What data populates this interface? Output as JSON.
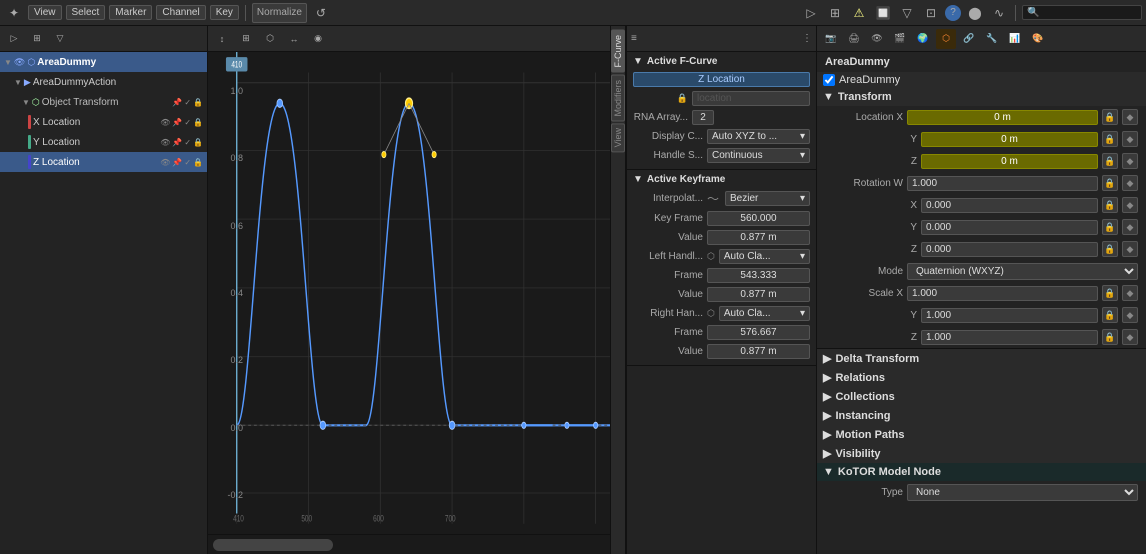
{
  "top_toolbar": {
    "menu_items": [
      "View",
      "Select",
      "Marker",
      "Channel",
      "Key"
    ],
    "normalize_label": "Normalize",
    "search_placeholder": ""
  },
  "left_panel": {
    "title": "AreaDummy",
    "action_name": "AreaDummyAction",
    "transform_label": "Object Transform",
    "channels": [
      {
        "id": "x-location",
        "label": "X Location",
        "color": "red"
      },
      {
        "id": "y-location",
        "label": "Y Location",
        "color": "green"
      },
      {
        "id": "z-location",
        "label": "Z Location",
        "color": "blue"
      }
    ]
  },
  "graph_editor": {
    "y_labels": [
      "1.0",
      "0.8",
      "0.6",
      "0.4",
      "0.2",
      "0.0",
      "-0.2"
    ],
    "x_labels": [
      "410",
      "500",
      "600",
      "700"
    ],
    "frame_current": "410"
  },
  "fcurve_tabs": [
    {
      "id": "fcurve",
      "label": "F-Curve",
      "active": true
    },
    {
      "id": "modifiers",
      "label": "Modifiers",
      "active": false
    },
    {
      "id": "view",
      "label": "View",
      "active": false
    }
  ],
  "active_fcurve": {
    "section_title": "Active F-Curve",
    "curve_label": "Z Location",
    "rna_label": "location",
    "rna_array_label": "RNA Array...",
    "rna_array_value": "2",
    "display_label": "Display C...",
    "display_value": "Auto XYZ to ...",
    "handle_label": "Handle S...",
    "handle_value": "Continuous",
    "active_keyframe_title": "Active Keyframe",
    "interpolation_label": "Interpolat...",
    "interpolation_value": "Bezier",
    "keyframe_label": "Key Frame",
    "keyframe_value": "560.000",
    "value_label": "Value",
    "value_value": "0.877 m",
    "left_handle_label": "Left Handl...",
    "left_handle_value": "Auto Cla...",
    "left_frame_label": "Frame",
    "left_frame_value": "543.333",
    "left_value_label": "Value",
    "left_value_value": "0.877 m",
    "right_handle_label": "Right Han...",
    "right_handle_value": "Auto Cla...",
    "right_frame_label": "Frame",
    "right_frame_value": "576.667",
    "right_value_label": "Value",
    "right_value_value": "0.877 m"
  },
  "properties_panel": {
    "object_name": "AreaDummy",
    "transform_label": "Transform",
    "location_x_label": "Location X",
    "location_x_value": "0 m",
    "location_y_label": "Y",
    "location_y_value": "0 m",
    "location_z_label": "Z",
    "location_z_value": "0 m",
    "rotation_w_label": "Rotation W",
    "rotation_w_value": "1.000",
    "rotation_x_label": "X",
    "rotation_x_value": "0.000",
    "rotation_y_label": "Y",
    "rotation_y_value": "0.000",
    "rotation_z_label": "Z",
    "rotation_z_value": "0.000",
    "mode_label": "Mode",
    "mode_value": "Quaternion (WXYZ)",
    "scale_x_label": "Scale X",
    "scale_x_value": "1.000",
    "scale_y_label": "Y",
    "scale_y_value": "1.000",
    "scale_z_label": "Z",
    "scale_z_value": "1.000",
    "delta_transform_label": "Delta Transform",
    "relations_label": "Relations",
    "collections_label": "Collections",
    "instancing_label": "Instancing",
    "motion_paths_label": "Motion Paths",
    "visibility_label": "Visibility",
    "kotor_label": "KoTOR Model Node",
    "type_label": "Type",
    "type_value": "None"
  }
}
